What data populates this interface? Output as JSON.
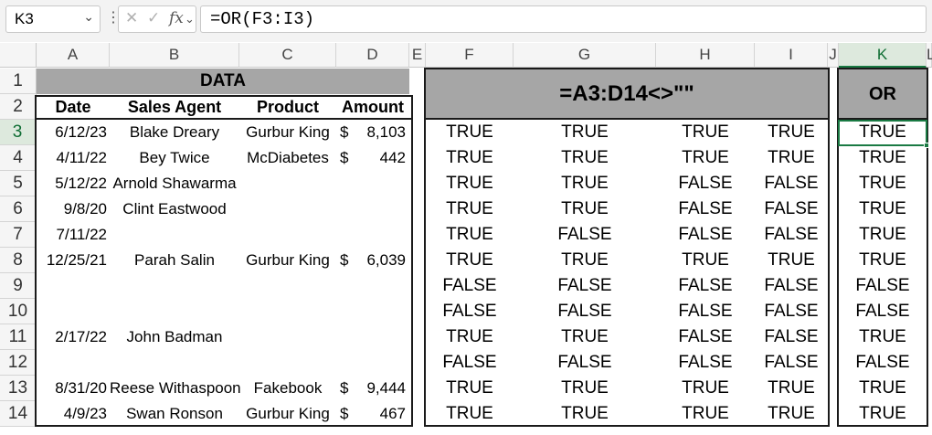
{
  "formula_bar": {
    "name_box": "K3",
    "chevron": "⌄",
    "dots": "⋮",
    "cancel": "✕",
    "enter": "✓",
    "fx": "fx",
    "formula": "=OR(F3:I3)"
  },
  "columns": [
    "A",
    "B",
    "C",
    "D",
    "E",
    "F",
    "G",
    "H",
    "I",
    "J",
    "K",
    "L"
  ],
  "rows": [
    "1",
    "2",
    "3",
    "4",
    "5",
    "6",
    "7",
    "8",
    "9",
    "10",
    "11",
    "12",
    "13",
    "14"
  ],
  "data_table": {
    "title": "DATA",
    "headers": [
      "Date",
      "Sales Agent",
      "Product",
      "Amount"
    ],
    "rows": [
      {
        "date": "6/12/23",
        "agent": "Blake Dreary",
        "product": "Gurbur King",
        "cur": "$",
        "amount": "8,103"
      },
      {
        "date": "4/11/22",
        "agent": "Bey Twice",
        "product": "McDiabetes",
        "cur": "$",
        "amount": "442"
      },
      {
        "date": "5/12/22",
        "agent": "Arnold Shawarma",
        "product": "",
        "cur": "",
        "amount": ""
      },
      {
        "date": "9/8/20",
        "agent": "Clint Eastwood",
        "product": "",
        "cur": "",
        "amount": ""
      },
      {
        "date": "7/11/22",
        "agent": "",
        "product": "",
        "cur": "",
        "amount": ""
      },
      {
        "date": "12/25/21",
        "agent": "Parah Salin",
        "product": "Gurbur King",
        "cur": "$",
        "amount": "6,039"
      },
      {
        "date": "",
        "agent": "",
        "product": "",
        "cur": "",
        "amount": ""
      },
      {
        "date": "",
        "agent": "",
        "product": "",
        "cur": "",
        "amount": ""
      },
      {
        "date": "2/17/22",
        "agent": "John Badman",
        "product": "",
        "cur": "",
        "amount": ""
      },
      {
        "date": "",
        "agent": "",
        "product": "",
        "cur": "",
        "amount": ""
      },
      {
        "date": "8/31/20",
        "agent": "Reese Withaspoon",
        "product": "Fakebook",
        "cur": "$",
        "amount": "9,444"
      },
      {
        "date": "4/9/23",
        "agent": "Swan Ronson",
        "product": "Gurbur King",
        "cur": "$",
        "amount": "467"
      }
    ]
  },
  "check_table": {
    "title": "=A3:D14<>\"\"",
    "rows": [
      [
        "TRUE",
        "TRUE",
        "TRUE",
        "TRUE"
      ],
      [
        "TRUE",
        "TRUE",
        "TRUE",
        "TRUE"
      ],
      [
        "TRUE",
        "TRUE",
        "FALSE",
        "FALSE"
      ],
      [
        "TRUE",
        "TRUE",
        "FALSE",
        "FALSE"
      ],
      [
        "TRUE",
        "FALSE",
        "FALSE",
        "FALSE"
      ],
      [
        "TRUE",
        "TRUE",
        "TRUE",
        "TRUE"
      ],
      [
        "FALSE",
        "FALSE",
        "FALSE",
        "FALSE"
      ],
      [
        "FALSE",
        "FALSE",
        "FALSE",
        "FALSE"
      ],
      [
        "TRUE",
        "TRUE",
        "FALSE",
        "FALSE"
      ],
      [
        "FALSE",
        "FALSE",
        "FALSE",
        "FALSE"
      ],
      [
        "TRUE",
        "TRUE",
        "TRUE",
        "TRUE"
      ],
      [
        "TRUE",
        "TRUE",
        "TRUE",
        "TRUE"
      ]
    ]
  },
  "or_table": {
    "title": "OR",
    "values": [
      "TRUE",
      "TRUE",
      "TRUE",
      "TRUE",
      "TRUE",
      "TRUE",
      "FALSE",
      "FALSE",
      "TRUE",
      "FALSE",
      "TRUE",
      "TRUE"
    ]
  },
  "colors": {
    "header_gray": "#a6a6a6",
    "selection_green": "#1a7a43"
  }
}
